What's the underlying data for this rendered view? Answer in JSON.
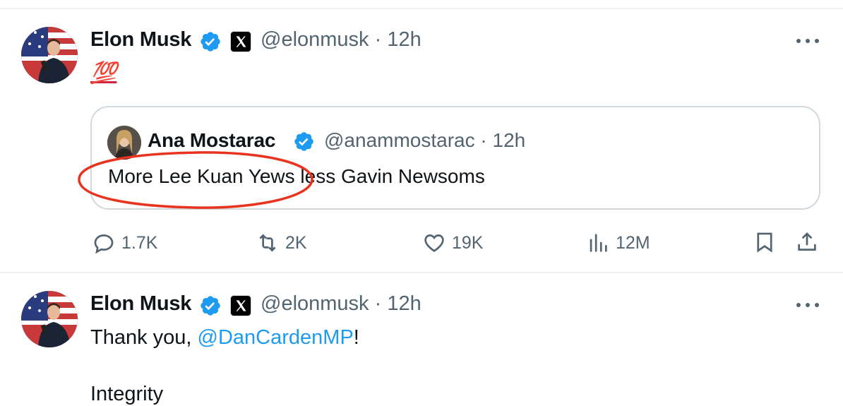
{
  "tweets": [
    {
      "author_name": "Elon Musk",
      "handle": "@elonmusk",
      "time": "· 12h",
      "emoji": "💯",
      "quote": {
        "author_name": "Ana Mostarac",
        "handle": "@anammostarac",
        "time": "· 12h",
        "text_highlighted": "More Lee Kuan Yews",
        "text_rest": " less Gavin Newsoms"
      },
      "actions": {
        "replies": "1.7K",
        "reposts": "2K",
        "likes": "19K",
        "views": "12M"
      }
    },
    {
      "author_name": "Elon Musk",
      "handle": "@elonmusk",
      "time": "· 12h",
      "text_prefix": "Thank you, ",
      "mention": "@DanCardenMP",
      "text_suffix": "!",
      "text_line2": "Integrity"
    }
  ],
  "colors": {
    "verified_blue": "#1d9bf0",
    "secondary_text": "#536471",
    "annotation_red": "#e8331f"
  },
  "icons": [
    "verified-badge-icon",
    "x-logo-icon",
    "more-icon",
    "reply-icon",
    "repost-icon",
    "like-icon",
    "views-icon",
    "bookmark-icon",
    "share-icon"
  ]
}
